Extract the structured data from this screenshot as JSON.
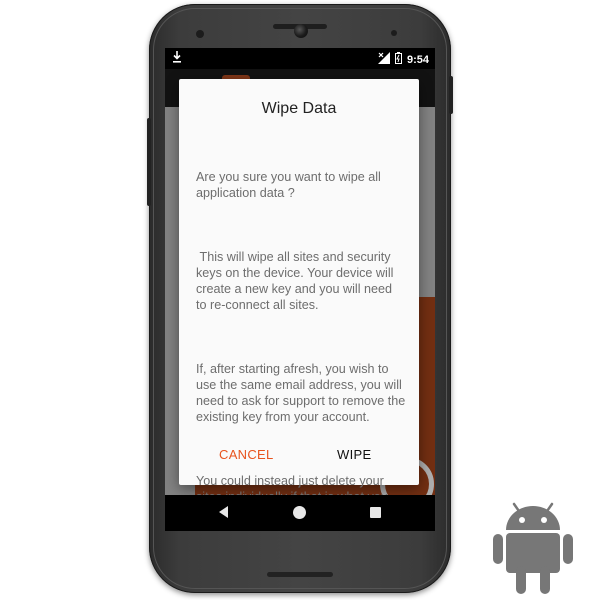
{
  "statusbar": {
    "time": "9:54",
    "download_icon": "download-icon",
    "signal_icon": "signal-icon",
    "battery_icon": "battery-icon"
  },
  "dialog": {
    "title": "Wipe Data",
    "paragraphs": [
      "Are you sure you want to wipe all application data ?",
      " This will wipe all sites and security keys on the device. Your device will create a new key and you will need to re-connect all sites.",
      "If, after starting afresh, you wish to use the same email address, you will need to ask for support to remove the existing key from your account.",
      "You could instead just delete your sites individually if that is what you wanted to do."
    ],
    "cancel_label": "CANCEL",
    "confirm_label": "WIPE"
  },
  "colors": {
    "accent": "#e8541e",
    "android_logo": "#777777"
  },
  "navbar": {
    "back_icon": "back-icon",
    "home_icon": "home-icon",
    "recents_icon": "recents-icon"
  }
}
